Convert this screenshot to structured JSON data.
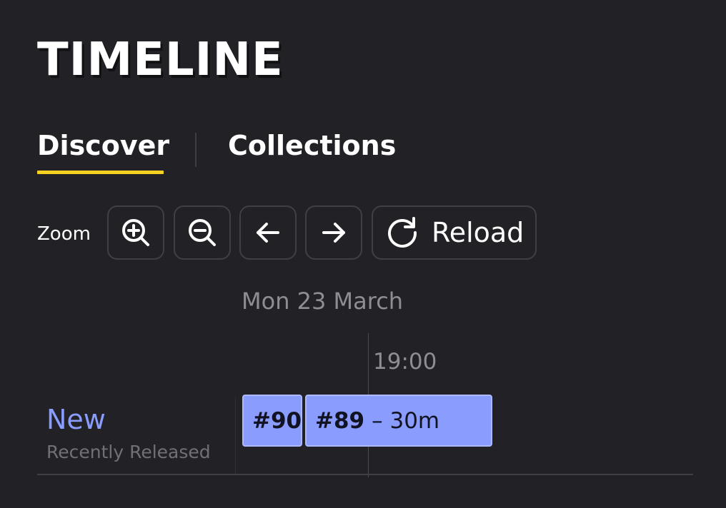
{
  "app": {
    "title": "TIMELINE"
  },
  "tabs": [
    {
      "label": "Discover",
      "active": true
    },
    {
      "label": "Collections",
      "active": false
    }
  ],
  "toolbar": {
    "zoom_label": "Zoom",
    "zoom_in_icon": "zoom-in-icon",
    "zoom_out_icon": "zoom-out-icon",
    "prev_icon": "arrow-left-icon",
    "next_icon": "arrow-right-icon",
    "reload_icon": "reload-icon",
    "reload_label": "Reload"
  },
  "timeline": {
    "date": "Mon 23 March",
    "time_marker": "19:00",
    "rows": [
      {
        "title": "New",
        "subtitle": "Recently Released",
        "episodes": [
          {
            "number": "#90",
            "duration": ""
          },
          {
            "number": "#89",
            "duration": "– 30m"
          }
        ]
      }
    ]
  },
  "colors": {
    "background": "#222226",
    "accent_underline": "#f5d222",
    "episode_block": "#8a9cfd",
    "row_title": "#8b9cff",
    "muted_text": "#8d8d93"
  }
}
